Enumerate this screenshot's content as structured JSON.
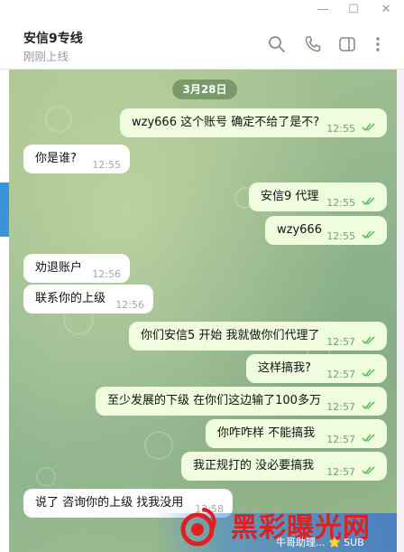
{
  "window": {
    "minimize": "—",
    "maximize": "☐",
    "close": "✕"
  },
  "header": {
    "title": "安信9专线",
    "status": "刚刚上线"
  },
  "date_separator": "3月28日",
  "messages": [
    {
      "dir": "out",
      "text": "wzy666 这个账号 确定不给了是不?",
      "time": "12:55"
    },
    {
      "dir": "in",
      "text": "你是谁?",
      "time": "12:55"
    },
    {
      "dir": "out",
      "text": "安信9 代理",
      "time": "12:55"
    },
    {
      "dir": "out",
      "text": "wzy666",
      "time": "12:55"
    },
    {
      "dir": "in",
      "text": "劝退账户",
      "time": "12:56"
    },
    {
      "dir": "in",
      "text": "联系你的上级",
      "time": "12:56"
    },
    {
      "dir": "out",
      "text": "你们安信5 开始 我就做你们代理了",
      "time": "12:57"
    },
    {
      "dir": "out",
      "text": "这样搞我?",
      "time": "12:57"
    },
    {
      "dir": "out",
      "text": "至少发展的下级 在你们这边输了100多万",
      "time": "12:57"
    },
    {
      "dir": "out",
      "text": "你咋咋样  不能搞我",
      "time": "12:57"
    },
    {
      "dir": "out",
      "text": "我正规打的 没必要搞我",
      "time": "12:57"
    },
    {
      "dir": "in",
      "text": "说了 咨询你的上级  找我没用",
      "time": "12:58"
    }
  ],
  "watermark": {
    "text": "黑彩曝光网",
    "sub": "牛哥助理... ⭐ SUB"
  }
}
